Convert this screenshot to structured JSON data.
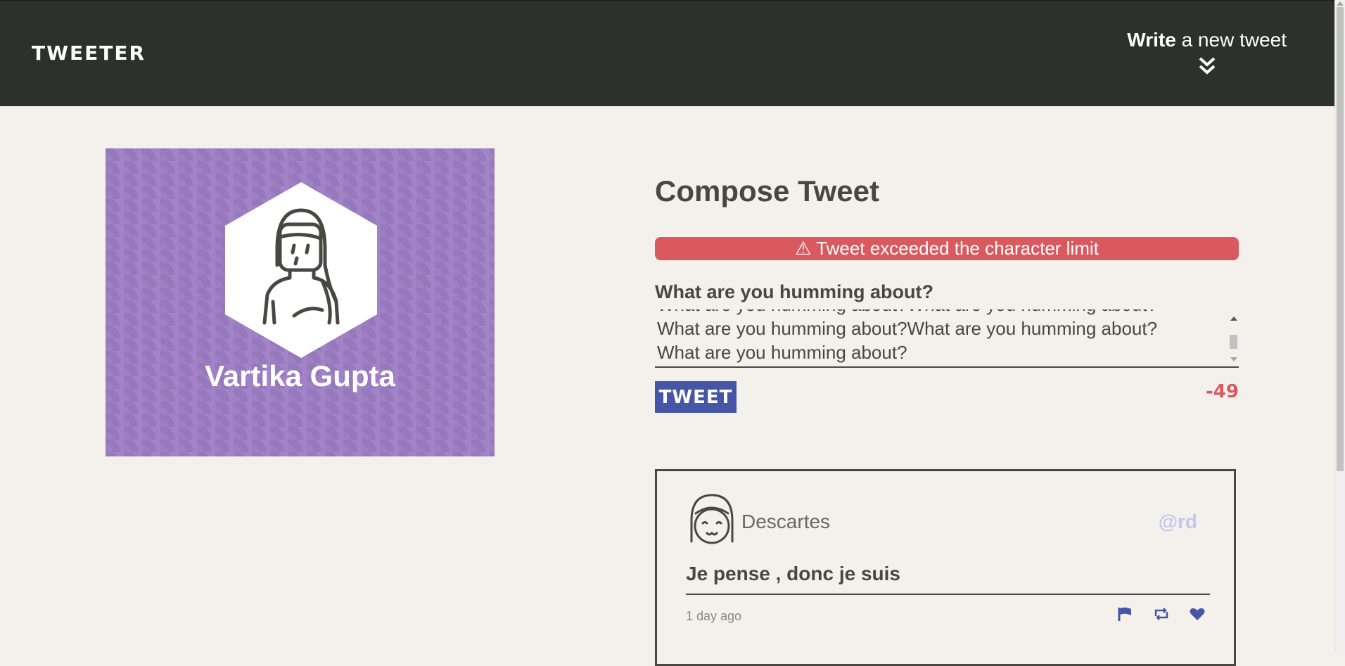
{
  "nav": {
    "brand": "TWEETER",
    "write_bold": "Write",
    "write_rest": " a new tweet",
    "chevron_icon": "double-chevron-down-icon"
  },
  "profile": {
    "name": "Vartika Gupta",
    "avatar_icon": "girl-avatar-icon",
    "background_color": "#a283c7"
  },
  "compose": {
    "title": "Compose Tweet",
    "error_icon": "warning-icon",
    "error_message": "⚠ Tweet exceeded the character limit",
    "label": "What are you humming about?",
    "text_lines": [
      "What are you humming about?What are you humming about?",
      "What are you humming about?What are you humming about?",
      "What are you humming about?"
    ],
    "button_label": "TWEET",
    "counter": "-49",
    "error_color": "#d9595f",
    "button_color": "#4556a6"
  },
  "tweets": [
    {
      "author": "Descartes",
      "handle": "@rd",
      "avatar_icon": "smiling-girl-avatar-icon",
      "content": "Je pense , donc je suis",
      "time": "1 day ago",
      "actions": [
        "flag-icon",
        "retweet-icon",
        "heart-icon"
      ]
    }
  ]
}
